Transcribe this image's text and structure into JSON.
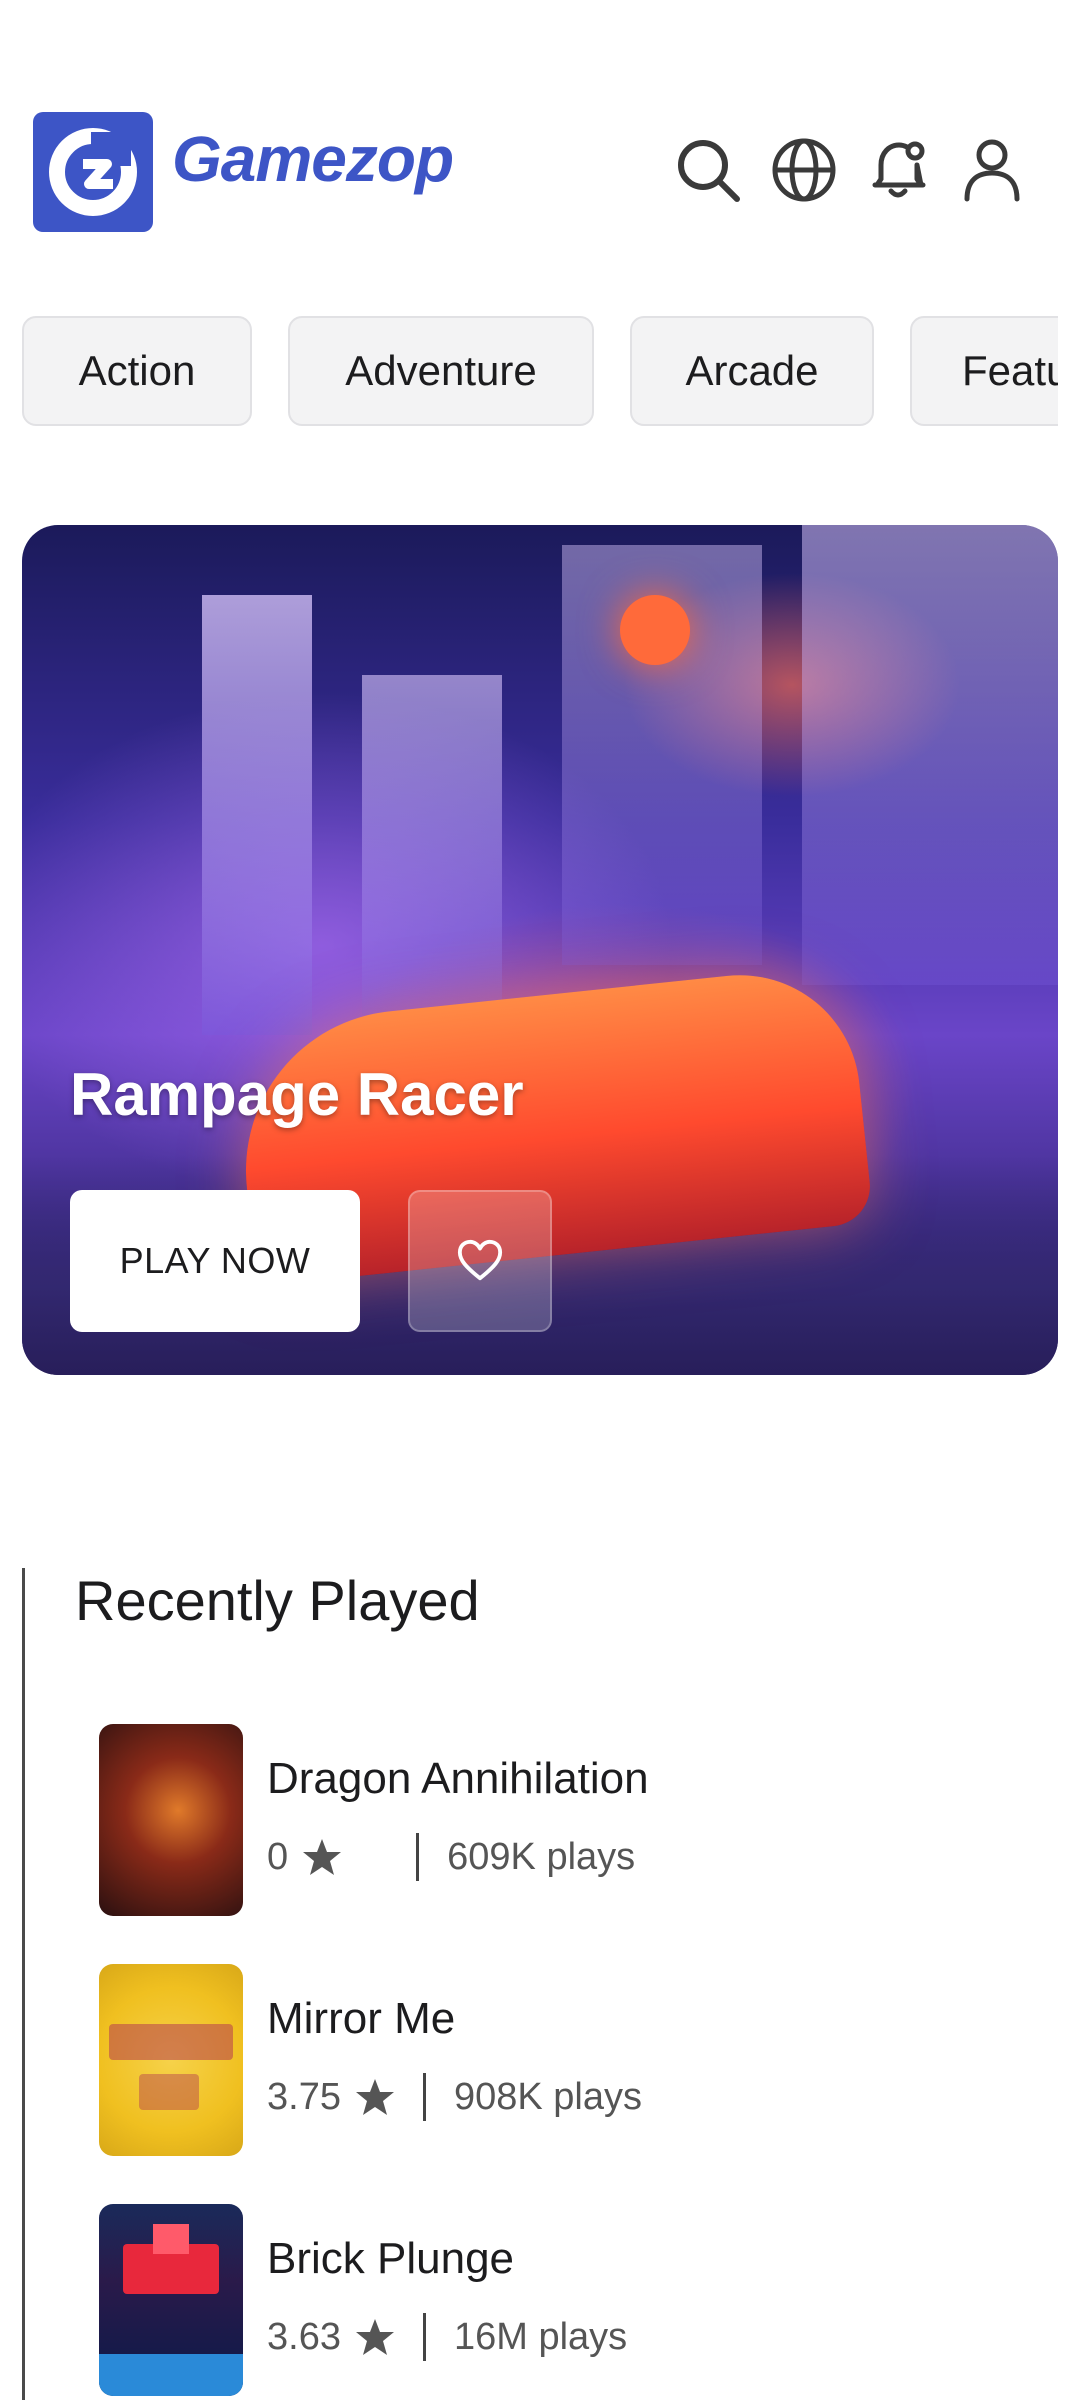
{
  "header": {
    "logo_alt": "Gamezop logo",
    "brand": "Gamezop",
    "brand_color": "#3d55c6",
    "icons": [
      "search-icon",
      "globe-icon",
      "notification-bell-icon",
      "user-icon"
    ]
  },
  "categories": [
    "Action",
    "Adventure",
    "Arcade",
    "Featu"
  ],
  "hero": {
    "title": "Rampage Racer",
    "play_label": "PLAY NOW",
    "favorite_icon": "heart-icon"
  },
  "recently_played": {
    "title": "Recently Played",
    "games": [
      {
        "name": "Dragon Annihilation",
        "rating": "0",
        "plays": "609K plays"
      },
      {
        "name": "Mirror Me",
        "rating": "3.75",
        "plays": "908K plays"
      },
      {
        "name": "Brick Plunge",
        "rating": "3.63",
        "plays": "16M plays"
      }
    ]
  }
}
